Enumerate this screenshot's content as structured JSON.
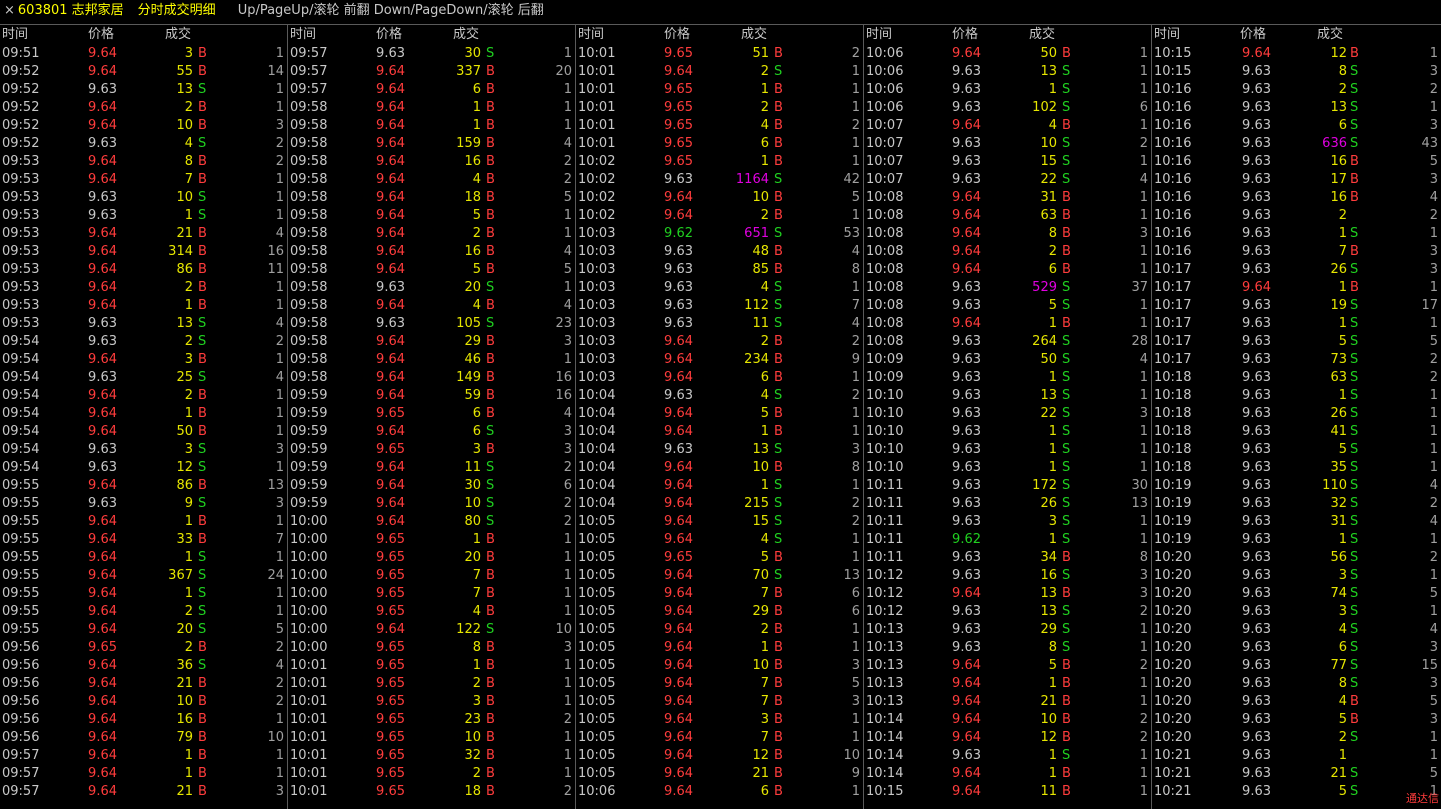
{
  "title": {
    "close": "×",
    "stock": "603801 志邦家居",
    "panel": "分时成交明细",
    "hint": "Up/PageUp/滚轮 前翻 Down/PageDown/滚轮 后翻"
  },
  "headers": {
    "time": "时间",
    "price": "价格",
    "volume": "成交"
  },
  "corner_label": "通达信",
  "colors": {
    "up": "#ff3c3c",
    "flat": "#c8c8c8",
    "down": "#20d020",
    "volume": "#e6e600",
    "big_volume": "#e000e0"
  },
  "ref_price": "9.63",
  "columns": [
    [
      [
        "09:51",
        "9.64",
        "3",
        "B",
        "1"
      ],
      [
        "09:52",
        "9.64",
        "55",
        "B",
        "14"
      ],
      [
        "09:52",
        "9.63",
        "13",
        "S",
        "1"
      ],
      [
        "09:52",
        "9.64",
        "2",
        "B",
        "1"
      ],
      [
        "09:52",
        "9.64",
        "10",
        "B",
        "3"
      ],
      [
        "09:52",
        "9.63",
        "4",
        "S",
        "2"
      ],
      [
        "09:53",
        "9.64",
        "8",
        "B",
        "2"
      ],
      [
        "09:53",
        "9.64",
        "7",
        "B",
        "1"
      ],
      [
        "09:53",
        "9.63",
        "10",
        "S",
        "1"
      ],
      [
        "09:53",
        "9.63",
        "1",
        "S",
        "1"
      ],
      [
        "09:53",
        "9.64",
        "21",
        "B",
        "4"
      ],
      [
        "09:53",
        "9.64",
        "314",
        "B",
        "16"
      ],
      [
        "09:53",
        "9.64",
        "86",
        "B",
        "11"
      ],
      [
        "09:53",
        "9.64",
        "2",
        "B",
        "1"
      ],
      [
        "09:53",
        "9.64",
        "1",
        "B",
        "1"
      ],
      [
        "09:53",
        "9.63",
        "13",
        "S",
        "4"
      ],
      [
        "09:54",
        "9.63",
        "2",
        "S",
        "2"
      ],
      [
        "09:54",
        "9.64",
        "3",
        "B",
        "1"
      ],
      [
        "09:54",
        "9.63",
        "25",
        "S",
        "4"
      ],
      [
        "09:54",
        "9.64",
        "2",
        "B",
        "1"
      ],
      [
        "09:54",
        "9.64",
        "1",
        "B",
        "1"
      ],
      [
        "09:54",
        "9.64",
        "50",
        "B",
        "1"
      ],
      [
        "09:54",
        "9.63",
        "3",
        "S",
        "3"
      ],
      [
        "09:54",
        "9.63",
        "12",
        "S",
        "1"
      ],
      [
        "09:55",
        "9.64",
        "86",
        "B",
        "13"
      ],
      [
        "09:55",
        "9.63",
        "9",
        "S",
        "3"
      ],
      [
        "09:55",
        "9.64",
        "1",
        "B",
        "1"
      ],
      [
        "09:55",
        "9.64",
        "33",
        "B",
        "7"
      ],
      [
        "09:55",
        "9.64",
        "1",
        "S",
        "1"
      ],
      [
        "09:55",
        "9.64",
        "367",
        "S",
        "24"
      ],
      [
        "09:55",
        "9.64",
        "1",
        "S",
        "1"
      ],
      [
        "09:55",
        "9.64",
        "2",
        "S",
        "1"
      ],
      [
        "09:55",
        "9.64",
        "20",
        "S",
        "5"
      ],
      [
        "09:56",
        "9.65",
        "2",
        "B",
        "2"
      ],
      [
        "09:56",
        "9.64",
        "36",
        "S",
        "4"
      ],
      [
        "09:56",
        "9.64",
        "21",
        "B",
        "2"
      ],
      [
        "09:56",
        "9.64",
        "10",
        "B",
        "2"
      ],
      [
        "09:56",
        "9.64",
        "16",
        "B",
        "1"
      ],
      [
        "09:56",
        "9.64",
        "79",
        "B",
        "10"
      ],
      [
        "09:57",
        "9.64",
        "1",
        "B",
        "1"
      ],
      [
        "09:57",
        "9.64",
        "1",
        "B",
        "1"
      ],
      [
        "09:57",
        "9.64",
        "21",
        "B",
        "3"
      ]
    ],
    [
      [
        "09:57",
        "9.63",
        "30",
        "S",
        "1"
      ],
      [
        "09:57",
        "9.64",
        "337",
        "B",
        "20"
      ],
      [
        "09:57",
        "9.64",
        "6",
        "B",
        "1"
      ],
      [
        "09:58",
        "9.64",
        "1",
        "B",
        "1"
      ],
      [
        "09:58",
        "9.64",
        "1",
        "B",
        "1"
      ],
      [
        "09:58",
        "9.64",
        "159",
        "B",
        "4"
      ],
      [
        "09:58",
        "9.64",
        "16",
        "B",
        "2"
      ],
      [
        "09:58",
        "9.64",
        "4",
        "B",
        "2"
      ],
      [
        "09:58",
        "9.64",
        "18",
        "B",
        "5"
      ],
      [
        "09:58",
        "9.64",
        "5",
        "B",
        "1"
      ],
      [
        "09:58",
        "9.64",
        "2",
        "B",
        "1"
      ],
      [
        "09:58",
        "9.64",
        "16",
        "B",
        "4"
      ],
      [
        "09:58",
        "9.64",
        "5",
        "B",
        "5"
      ],
      [
        "09:58",
        "9.63",
        "20",
        "S",
        "1"
      ],
      [
        "09:58",
        "9.64",
        "4",
        "B",
        "4"
      ],
      [
        "09:58",
        "9.63",
        "105",
        "S",
        "23"
      ],
      [
        "09:58",
        "9.64",
        "29",
        "B",
        "3"
      ],
      [
        "09:58",
        "9.64",
        "46",
        "B",
        "1"
      ],
      [
        "09:58",
        "9.64",
        "149",
        "B",
        "16"
      ],
      [
        "09:59",
        "9.64",
        "59",
        "B",
        "16"
      ],
      [
        "09:59",
        "9.65",
        "6",
        "B",
        "4"
      ],
      [
        "09:59",
        "9.64",
        "6",
        "S",
        "3"
      ],
      [
        "09:59",
        "9.65",
        "3",
        "B",
        "3"
      ],
      [
        "09:59",
        "9.64",
        "11",
        "S",
        "2"
      ],
      [
        "09:59",
        "9.64",
        "30",
        "S",
        "6"
      ],
      [
        "09:59",
        "9.64",
        "10",
        "S",
        "2"
      ],
      [
        "10:00",
        "9.64",
        "80",
        "S",
        "2"
      ],
      [
        "10:00",
        "9.65",
        "1",
        "B",
        "1"
      ],
      [
        "10:00",
        "9.65",
        "20",
        "B",
        "1"
      ],
      [
        "10:00",
        "9.65",
        "7",
        "B",
        "1"
      ],
      [
        "10:00",
        "9.65",
        "7",
        "B",
        "1"
      ],
      [
        "10:00",
        "9.65",
        "4",
        "B",
        "1"
      ],
      [
        "10:00",
        "9.64",
        "122",
        "S",
        "10"
      ],
      [
        "10:00",
        "9.65",
        "8",
        "B",
        "3"
      ],
      [
        "10:01",
        "9.65",
        "1",
        "B",
        "1"
      ],
      [
        "10:01",
        "9.65",
        "2",
        "B",
        "1"
      ],
      [
        "10:01",
        "9.65",
        "3",
        "B",
        "1"
      ],
      [
        "10:01",
        "9.65",
        "23",
        "B",
        "2"
      ],
      [
        "10:01",
        "9.65",
        "10",
        "B",
        "1"
      ],
      [
        "10:01",
        "9.65",
        "32",
        "B",
        "1"
      ],
      [
        "10:01",
        "9.65",
        "2",
        "B",
        "1"
      ],
      [
        "10:01",
        "9.65",
        "18",
        "B",
        "2"
      ]
    ],
    [
      [
        "10:01",
        "9.65",
        "51",
        "B",
        "2"
      ],
      [
        "10:01",
        "9.64",
        "2",
        "S",
        "1"
      ],
      [
        "10:01",
        "9.65",
        "1",
        "B",
        "1"
      ],
      [
        "10:01",
        "9.65",
        "2",
        "B",
        "1"
      ],
      [
        "10:01",
        "9.65",
        "4",
        "B",
        "2"
      ],
      [
        "10:01",
        "9.65",
        "6",
        "B",
        "1"
      ],
      [
        "10:02",
        "9.65",
        "1",
        "B",
        "1"
      ],
      [
        "10:02",
        "9.63",
        "1164",
        "S",
        "42"
      ],
      [
        "10:02",
        "9.64",
        "10",
        "B",
        "5"
      ],
      [
        "10:02",
        "9.64",
        "2",
        "B",
        "1"
      ],
      [
        "10:03",
        "9.62",
        "651",
        "S",
        "53"
      ],
      [
        "10:03",
        "9.63",
        "48",
        "B",
        "4"
      ],
      [
        "10:03",
        "9.63",
        "85",
        "B",
        "8"
      ],
      [
        "10:03",
        "9.63",
        "4",
        "S",
        "1"
      ],
      [
        "10:03",
        "9.63",
        "112",
        "S",
        "7"
      ],
      [
        "10:03",
        "9.63",
        "11",
        "S",
        "4"
      ],
      [
        "10:03",
        "9.64",
        "2",
        "B",
        "2"
      ],
      [
        "10:03",
        "9.64",
        "234",
        "B",
        "9"
      ],
      [
        "10:03",
        "9.64",
        "6",
        "B",
        "1"
      ],
      [
        "10:04",
        "9.63",
        "4",
        "S",
        "2"
      ],
      [
        "10:04",
        "9.64",
        "5",
        "B",
        "1"
      ],
      [
        "10:04",
        "9.64",
        "1",
        "B",
        "1"
      ],
      [
        "10:04",
        "9.63",
        "13",
        "S",
        "3"
      ],
      [
        "10:04",
        "9.64",
        "10",
        "B",
        "8"
      ],
      [
        "10:04",
        "9.64",
        "1",
        "S",
        "1"
      ],
      [
        "10:04",
        "9.64",
        "215",
        "S",
        "2"
      ],
      [
        "10:05",
        "9.64",
        "15",
        "S",
        "2"
      ],
      [
        "10:05",
        "9.64",
        "4",
        "S",
        "1"
      ],
      [
        "10:05",
        "9.65",
        "5",
        "B",
        "1"
      ],
      [
        "10:05",
        "9.64",
        "70",
        "S",
        "13"
      ],
      [
        "10:05",
        "9.64",
        "7",
        "B",
        "6"
      ],
      [
        "10:05",
        "9.64",
        "29",
        "B",
        "6"
      ],
      [
        "10:05",
        "9.64",
        "2",
        "B",
        "1"
      ],
      [
        "10:05",
        "9.64",
        "1",
        "B",
        "1"
      ],
      [
        "10:05",
        "9.64",
        "10",
        "B",
        "3"
      ],
      [
        "10:05",
        "9.64",
        "7",
        "B",
        "5"
      ],
      [
        "10:05",
        "9.64",
        "7",
        "B",
        "3"
      ],
      [
        "10:05",
        "9.64",
        "3",
        "B",
        "1"
      ],
      [
        "10:05",
        "9.64",
        "7",
        "B",
        "1"
      ],
      [
        "10:05",
        "9.64",
        "12",
        "B",
        "10"
      ],
      [
        "10:05",
        "9.64",
        "21",
        "B",
        "9"
      ],
      [
        "10:06",
        "9.64",
        "6",
        "B",
        "1"
      ]
    ],
    [
      [
        "10:06",
        "9.64",
        "50",
        "B",
        "1"
      ],
      [
        "10:06",
        "9.63",
        "13",
        "S",
        "1"
      ],
      [
        "10:06",
        "9.63",
        "1",
        "S",
        "1"
      ],
      [
        "10:06",
        "9.63",
        "102",
        "S",
        "6"
      ],
      [
        "10:07",
        "9.64",
        "4",
        "B",
        "1"
      ],
      [
        "10:07",
        "9.63",
        "10",
        "S",
        "2"
      ],
      [
        "10:07",
        "9.63",
        "15",
        "S",
        "1"
      ],
      [
        "10:07",
        "9.63",
        "22",
        "S",
        "4"
      ],
      [
        "10:08",
        "9.64",
        "31",
        "B",
        "1"
      ],
      [
        "10:08",
        "9.64",
        "63",
        "B",
        "1"
      ],
      [
        "10:08",
        "9.64",
        "8",
        "B",
        "3"
      ],
      [
        "10:08",
        "9.64",
        "2",
        "B",
        "1"
      ],
      [
        "10:08",
        "9.64",
        "6",
        "B",
        "1"
      ],
      [
        "10:08",
        "9.63",
        "529",
        "S",
        "37"
      ],
      [
        "10:08",
        "9.63",
        "5",
        "S",
        "1"
      ],
      [
        "10:08",
        "9.64",
        "1",
        "B",
        "1"
      ],
      [
        "10:08",
        "9.63",
        "264",
        "S",
        "28"
      ],
      [
        "10:09",
        "9.63",
        "50",
        "S",
        "4"
      ],
      [
        "10:09",
        "9.63",
        "1",
        "S",
        "1"
      ],
      [
        "10:10",
        "9.63",
        "13",
        "S",
        "1"
      ],
      [
        "10:10",
        "9.63",
        "22",
        "S",
        "3"
      ],
      [
        "10:10",
        "9.63",
        "1",
        "S",
        "1"
      ],
      [
        "10:10",
        "9.63",
        "1",
        "S",
        "1"
      ],
      [
        "10:10",
        "9.63",
        "1",
        "S",
        "1"
      ],
      [
        "10:11",
        "9.63",
        "172",
        "S",
        "30"
      ],
      [
        "10:11",
        "9.63",
        "26",
        "S",
        "13"
      ],
      [
        "10:11",
        "9.63",
        "3",
        "S",
        "1"
      ],
      [
        "10:11",
        "9.62",
        "1",
        "S",
        "1"
      ],
      [
        "10:11",
        "9.63",
        "34",
        "B",
        "8"
      ],
      [
        "10:12",
        "9.63",
        "16",
        "S",
        "3"
      ],
      [
        "10:12",
        "9.64",
        "13",
        "B",
        "3"
      ],
      [
        "10:12",
        "9.63",
        "13",
        "S",
        "2"
      ],
      [
        "10:13",
        "9.63",
        "29",
        "S",
        "1"
      ],
      [
        "10:13",
        "9.63",
        "8",
        "S",
        "1"
      ],
      [
        "10:13",
        "9.64",
        "5",
        "B",
        "2"
      ],
      [
        "10:13",
        "9.64",
        "1",
        "B",
        "1"
      ],
      [
        "10:13",
        "9.64",
        "21",
        "B",
        "1"
      ],
      [
        "10:14",
        "9.64",
        "10",
        "B",
        "2"
      ],
      [
        "10:14",
        "9.64",
        "12",
        "B",
        "2"
      ],
      [
        "10:14",
        "9.63",
        "1",
        "S",
        "1"
      ],
      [
        "10:14",
        "9.64",
        "1",
        "B",
        "1"
      ],
      [
        "10:15",
        "9.64",
        "11",
        "B",
        "1"
      ]
    ],
    [
      [
        "10:15",
        "9.64",
        "12",
        "B",
        "1"
      ],
      [
        "10:15",
        "9.63",
        "8",
        "S",
        "3"
      ],
      [
        "10:16",
        "9.63",
        "2",
        "S",
        "2"
      ],
      [
        "10:16",
        "9.63",
        "13",
        "S",
        "1"
      ],
      [
        "10:16",
        "9.63",
        "6",
        "S",
        "3"
      ],
      [
        "10:16",
        "9.63",
        "636",
        "S",
        "43"
      ],
      [
        "10:16",
        "9.63",
        "16",
        "B",
        "5"
      ],
      [
        "10:16",
        "9.63",
        "17",
        "B",
        "3"
      ],
      [
        "10:16",
        "9.63",
        "16",
        "B",
        "4"
      ],
      [
        "10:16",
        "9.63",
        "2",
        "",
        "2"
      ],
      [
        "10:16",
        "9.63",
        "1",
        "S",
        "1"
      ],
      [
        "10:16",
        "9.63",
        "7",
        "B",
        "3"
      ],
      [
        "10:17",
        "9.63",
        "26",
        "S",
        "3"
      ],
      [
        "10:17",
        "9.64",
        "1",
        "B",
        "1"
      ],
      [
        "10:17",
        "9.63",
        "19",
        "S",
        "17"
      ],
      [
        "10:17",
        "9.63",
        "1",
        "S",
        "1"
      ],
      [
        "10:17",
        "9.63",
        "5",
        "S",
        "5"
      ],
      [
        "10:17",
        "9.63",
        "73",
        "S",
        "2"
      ],
      [
        "10:18",
        "9.63",
        "63",
        "S",
        "2"
      ],
      [
        "10:18",
        "9.63",
        "1",
        "S",
        "1"
      ],
      [
        "10:18",
        "9.63",
        "26",
        "S",
        "1"
      ],
      [
        "10:18",
        "9.63",
        "41",
        "S",
        "1"
      ],
      [
        "10:18",
        "9.63",
        "5",
        "S",
        "1"
      ],
      [
        "10:18",
        "9.63",
        "35",
        "S",
        "1"
      ],
      [
        "10:19",
        "9.63",
        "110",
        "S",
        "4"
      ],
      [
        "10:19",
        "9.63",
        "32",
        "S",
        "2"
      ],
      [
        "10:19",
        "9.63",
        "31",
        "S",
        "4"
      ],
      [
        "10:19",
        "9.63",
        "1",
        "S",
        "1"
      ],
      [
        "10:20",
        "9.63",
        "56",
        "S",
        "2"
      ],
      [
        "10:20",
        "9.63",
        "3",
        "S",
        "1"
      ],
      [
        "10:20",
        "9.63",
        "74",
        "S",
        "5"
      ],
      [
        "10:20",
        "9.63",
        "3",
        "S",
        "1"
      ],
      [
        "10:20",
        "9.63",
        "4",
        "S",
        "4"
      ],
      [
        "10:20",
        "9.63",
        "6",
        "S",
        "3"
      ],
      [
        "10:20",
        "9.63",
        "77",
        "S",
        "15"
      ],
      [
        "10:20",
        "9.63",
        "8",
        "S",
        "3"
      ],
      [
        "10:20",
        "9.63",
        "4",
        "B",
        "5"
      ],
      [
        "10:20",
        "9.63",
        "5",
        "B",
        "3"
      ],
      [
        "10:20",
        "9.63",
        "2",
        "S",
        "1"
      ],
      [
        "10:21",
        "9.63",
        "1",
        "",
        "1"
      ],
      [
        "10:21",
        "9.63",
        "21",
        "S",
        "5"
      ],
      [
        "10:21",
        "9.63",
        "5",
        "S",
        "1"
      ]
    ]
  ]
}
